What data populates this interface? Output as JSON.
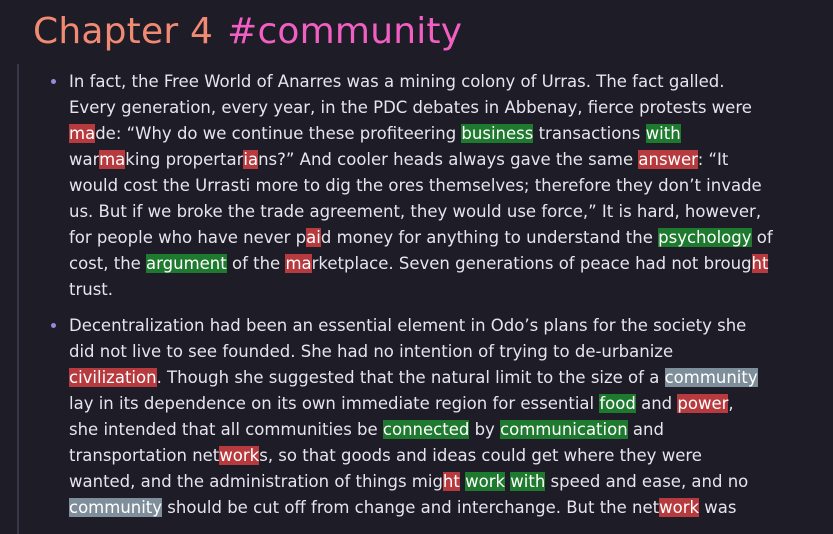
{
  "title": {
    "chapter": "Chapter 4",
    "tag": "#community"
  },
  "colors": {
    "title_chapter": "#f08a72",
    "title_tag": "#f25fc2",
    "highlight_red": "#b73a3e",
    "highlight_green": "#1e7a2e",
    "highlight_gray": "#7e8e9a",
    "bullet": "#9a88d8"
  },
  "bullets": [
    {
      "lines": [
        [
          {
            "t": "In fact, the Free World of Anarres was a mining colony of Urras. The fact galled."
          }
        ],
        [
          {
            "t": "Every generation, every year, in the PDC debates in Abbenay, fierce protests were"
          }
        ],
        [
          {
            "t": "ma",
            "h": "red"
          },
          {
            "t": "de: “Why do we continue these profiteering "
          },
          {
            "t": "business",
            "h": "green"
          },
          {
            "t": " transactions "
          },
          {
            "t": "with",
            "h": "green"
          }
        ],
        [
          {
            "t": "war"
          },
          {
            "t": "ma",
            "h": "red"
          },
          {
            "t": "king propertar"
          },
          {
            "t": "ia",
            "h": "red"
          },
          {
            "t": "ns?” And cooler heads always gave the same "
          },
          {
            "t": "answer",
            "h": "red"
          },
          {
            "t": ": “It"
          }
        ],
        [
          {
            "t": "would cost the Urrasti more to dig the ores themselves; therefore they don’t invade"
          }
        ],
        [
          {
            "t": "us. But if we broke the trade agreement, they would use force,” It is hard, however,"
          }
        ],
        [
          {
            "t": "for people who have never p"
          },
          {
            "t": "ai",
            "h": "red"
          },
          {
            "t": "d money for anything to understand the "
          },
          {
            "t": "psychology",
            "h": "green"
          },
          {
            "t": " of"
          }
        ],
        [
          {
            "t": "cost, the "
          },
          {
            "t": "argument",
            "h": "green"
          },
          {
            "t": " of the "
          },
          {
            "t": "ma",
            "h": "red"
          },
          {
            "t": "rketplace. Seven generations of peace had not broug"
          },
          {
            "t": "ht",
            "h": "red"
          }
        ],
        [
          {
            "t": "trust."
          }
        ]
      ]
    },
    {
      "lines": [
        [
          {
            "t": "Decentralization had been an essential element in Odo’s plans for the society she"
          }
        ],
        [
          {
            "t": "did not live to see founded. She had no intention of trying to de-urbanize"
          }
        ],
        [
          {
            "t": "civilization",
            "h": "red"
          },
          {
            "t": ". Though she suggested that the natural limit to the size of a "
          },
          {
            "t": "community",
            "h": "gray"
          }
        ],
        [
          {
            "t": "lay in its dependence on its own immediate region for essential "
          },
          {
            "t": "food",
            "h": "green"
          },
          {
            "t": " and "
          },
          {
            "t": "power",
            "h": "red"
          },
          {
            "t": ","
          }
        ],
        [
          {
            "t": "she intended that all communities be "
          },
          {
            "t": "connected",
            "h": "green"
          },
          {
            "t": " by "
          },
          {
            "t": "communication",
            "h": "green"
          },
          {
            "t": " and"
          }
        ],
        [
          {
            "t": "transportation net"
          },
          {
            "t": "work",
            "h": "red"
          },
          {
            "t": "s, so that goods and ideas could get where they were"
          }
        ],
        [
          {
            "t": "wanted, and the administration of things mig"
          },
          {
            "t": "ht",
            "h": "red"
          },
          {
            "t": " "
          },
          {
            "t": "work",
            "h": "green"
          },
          {
            "t": " "
          },
          {
            "t": "with",
            "h": "green"
          },
          {
            "t": " speed and ease, and no"
          }
        ],
        [
          {
            "t": "community",
            "h": "gray"
          },
          {
            "t": " should be cut off from change and interchange. But the net"
          },
          {
            "t": "work",
            "h": "red"
          },
          {
            "t": " was"
          }
        ]
      ]
    }
  ]
}
